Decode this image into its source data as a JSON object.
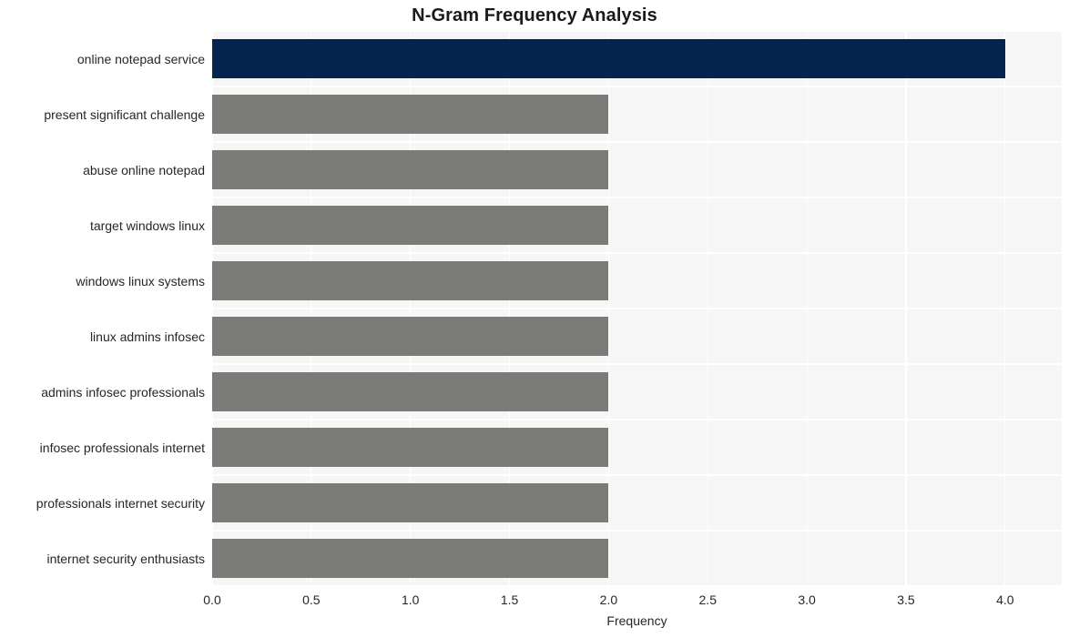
{
  "chart_data": {
    "type": "bar",
    "orientation": "horizontal",
    "title": "N-Gram Frequency Analysis",
    "xlabel": "Frequency",
    "ylabel": "",
    "categories": [
      "online notepad service",
      "present significant challenge",
      "abuse online notepad",
      "target windows linux",
      "windows linux systems",
      "linux admins infosec",
      "admins infosec professionals",
      "infosec professionals internet",
      "professionals internet security",
      "internet security enthusiasts"
    ],
    "values": [
      4,
      2,
      2,
      2,
      2,
      2,
      2,
      2,
      2,
      2
    ],
    "xlim": [
      0,
      4.2857
    ],
    "xticks": [
      0,
      0.5,
      1,
      1.5,
      2,
      2.5,
      3,
      3.5,
      4
    ],
    "xtick_labels": [
      "0.0",
      "0.5",
      "1.0",
      "1.5",
      "2.0",
      "2.5",
      "3.0",
      "3.5",
      "4.0"
    ],
    "grid": true,
    "legend": null,
    "colors": {
      "highlight": "#042450",
      "normal": "#7b7b78",
      "plot_background": "#f6f6f6",
      "figure_background": "#ffffff",
      "gridline": "#ffffff",
      "text": "#262626",
      "title": "#1a1a1a"
    },
    "highlight_index": 0
  }
}
